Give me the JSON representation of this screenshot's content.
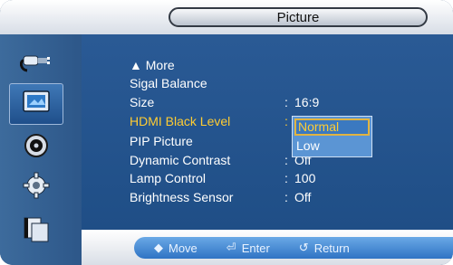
{
  "window": {
    "title": "Picture"
  },
  "sidebar": {
    "items": [
      {
        "id": "input",
        "icon": "input-plug-icon",
        "active": false
      },
      {
        "id": "picture",
        "icon": "picture-icon",
        "active": true
      },
      {
        "id": "sound",
        "icon": "sound-icon",
        "active": false
      },
      {
        "id": "setup",
        "icon": "setup-gear-icon",
        "active": false
      },
      {
        "id": "multi",
        "icon": "multi-window-icon",
        "active": false
      }
    ]
  },
  "menu": {
    "rows": [
      {
        "label": "▲ More",
        "value": ""
      },
      {
        "label": "Sigal Balance",
        "value": ""
      },
      {
        "label": "Size",
        "colon": ":",
        "value": "16:9"
      },
      {
        "label": "HDMI Black Level",
        "colon": ":",
        "value": ""
      },
      {
        "label": "PIP Picture",
        "colon": "",
        "value": ""
      },
      {
        "label": "Dynamic Contrast",
        "colon": ":",
        "value": "Off"
      },
      {
        "label": "Lamp Control",
        "colon": ":",
        "value": "100"
      },
      {
        "label": "Brightness Sensor",
        "colon": ":",
        "value": "Off"
      }
    ],
    "highlighted_row": "HDMI Black Level"
  },
  "dropdown": {
    "options": [
      "Normal",
      "Low"
    ],
    "selected": "Normal"
  },
  "footer": {
    "move": "Move",
    "enter": "Enter",
    "return": "Return"
  },
  "colors": {
    "panel": "#1f4e86",
    "highlight_text": "#ffcc33",
    "accent_border": "#e1b441"
  }
}
